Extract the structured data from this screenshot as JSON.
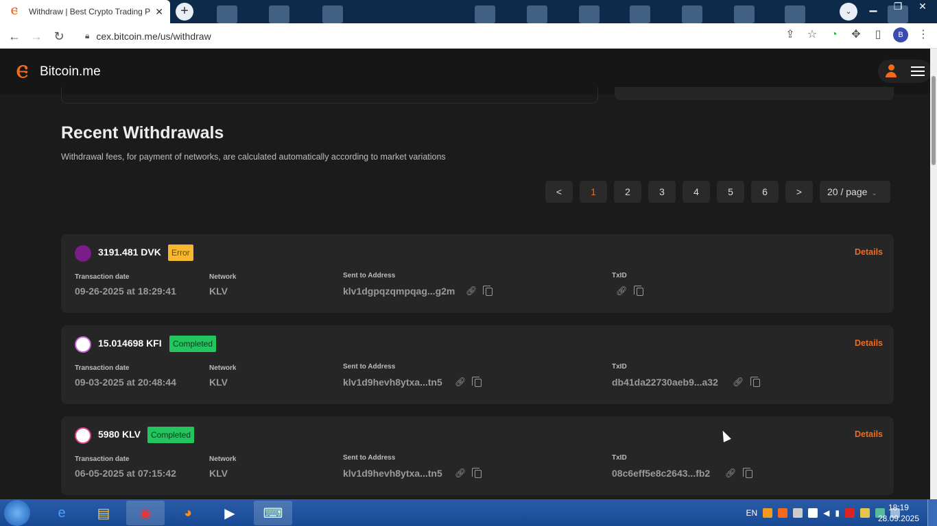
{
  "browser": {
    "tab_title": "Withdraw | Best Crypto Trading P",
    "url": "cex.bitcoin.me/us/withdraw",
    "profile_initial": "B"
  },
  "site": {
    "logo_text": "Bitcoin.me"
  },
  "section": {
    "title": "Recent Withdrawals",
    "subtitle": "Withdrawal fees, for payment of networks, are calculated automatically according to market variations"
  },
  "pagination": {
    "prev": "<",
    "pages": [
      "1",
      "2",
      "3",
      "4",
      "5",
      "6"
    ],
    "active_page": "1",
    "next": ">",
    "page_size": "20 / page"
  },
  "labels": {
    "transaction_date": "Transaction date",
    "network": "Network",
    "sent_to": "Sent to Address",
    "txid": "TxID",
    "details": "Details"
  },
  "withdrawals": [
    {
      "amount": "3191.481 DVK",
      "status": "Error",
      "date": "09-26-2025 at 18:29:41",
      "network": "KLV",
      "address": "klv1dgpqzqmpqag...g2m",
      "txid": "",
      "coin_color": "#7a1d8a"
    },
    {
      "amount": "15.014698 KFI",
      "status": "Completed",
      "date": "09-03-2025 at 20:48:44",
      "network": "KLV",
      "address": "klv1d9hevh8ytxa...tn5",
      "txid": "db41da22730aeb9...a32",
      "coin_color": "#ffffff"
    },
    {
      "amount": "5980 KLV",
      "status": "Completed",
      "date": "06-05-2025 at 07:15:42",
      "network": "KLV",
      "address": "klv1d9hevh8ytxa...tn5",
      "txid": "08c6eff5e8c2643...fb2",
      "coin_color": "#ffffff"
    }
  ],
  "taskbar": {
    "lang": "EN",
    "time": "18:19",
    "date": "28.09.2025"
  },
  "colors": {
    "accent": "#f26a1b",
    "error_badge": "#f5b82e",
    "completed_badge": "#22c55e"
  }
}
